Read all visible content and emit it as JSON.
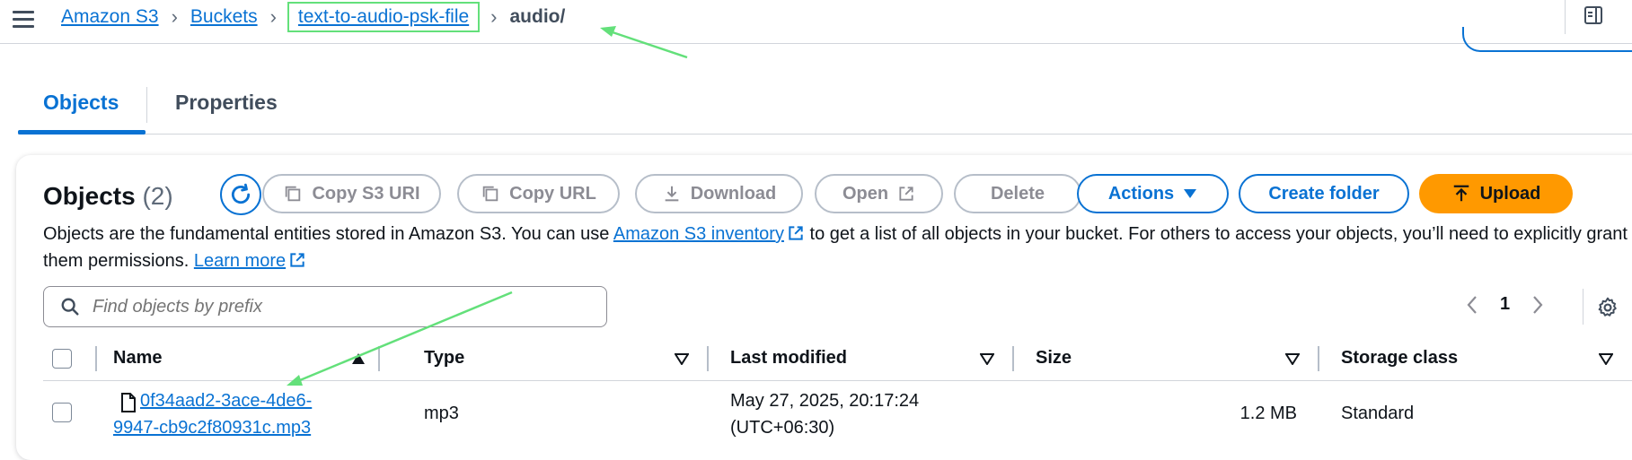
{
  "breadcrumb": {
    "items": [
      "Amazon S3",
      "Buckets",
      "text-to-audio-psk-file"
    ],
    "current": "audio/"
  },
  "tabs": [
    {
      "label": "Objects",
      "active": true
    },
    {
      "label": "Properties",
      "active": false
    }
  ],
  "objects_panel": {
    "title": "Objects",
    "count": "(2)",
    "buttons": {
      "copy_s3_uri": "Copy S3 URI",
      "copy_url": "Copy URL",
      "download": "Download",
      "open": "Open",
      "delete": "Delete",
      "actions": "Actions",
      "create_folder": "Create folder",
      "upload": "Upload"
    },
    "description": {
      "part1": "Objects are the fundamental entities stored in Amazon S3. You can use ",
      "inventory_link": "Amazon S3 inventory",
      "part2": " to get a list of all objects in your bucket. For others to access your objects, you’ll need to explicitly grant them permissions. ",
      "learn_more": "Learn more"
    },
    "search": {
      "placeholder": "Find objects by prefix"
    },
    "pagination": {
      "current_page": "1"
    }
  },
  "table": {
    "columns": [
      "Name",
      "Type",
      "Last modified",
      "Size",
      "Storage class"
    ],
    "rows": [
      {
        "name_line1": "0f34aad2-3ace-4de6-",
        "name_line2": "9947-cb9c2f80931c.mp3",
        "type": "mp3",
        "modified_line1": "May 27, 2025, 20:17:24",
        "modified_line2": "(UTC+06:30)",
        "size": "1.2 MB",
        "storage_class": "Standard"
      }
    ]
  },
  "colors": {
    "link": "#0972d3",
    "primary_button": "#ff9900",
    "annotation": "#63e07a"
  },
  "icons": [
    "menu-icon",
    "chevron-right-icon",
    "side-panel-icon",
    "refresh-icon",
    "copy-icon",
    "download-icon",
    "external-link-icon",
    "caret-down-icon",
    "upload-icon",
    "search-icon",
    "chevron-left-icon",
    "gear-icon",
    "sort-ascending-icon",
    "filter-caret-icon",
    "file-icon"
  ]
}
